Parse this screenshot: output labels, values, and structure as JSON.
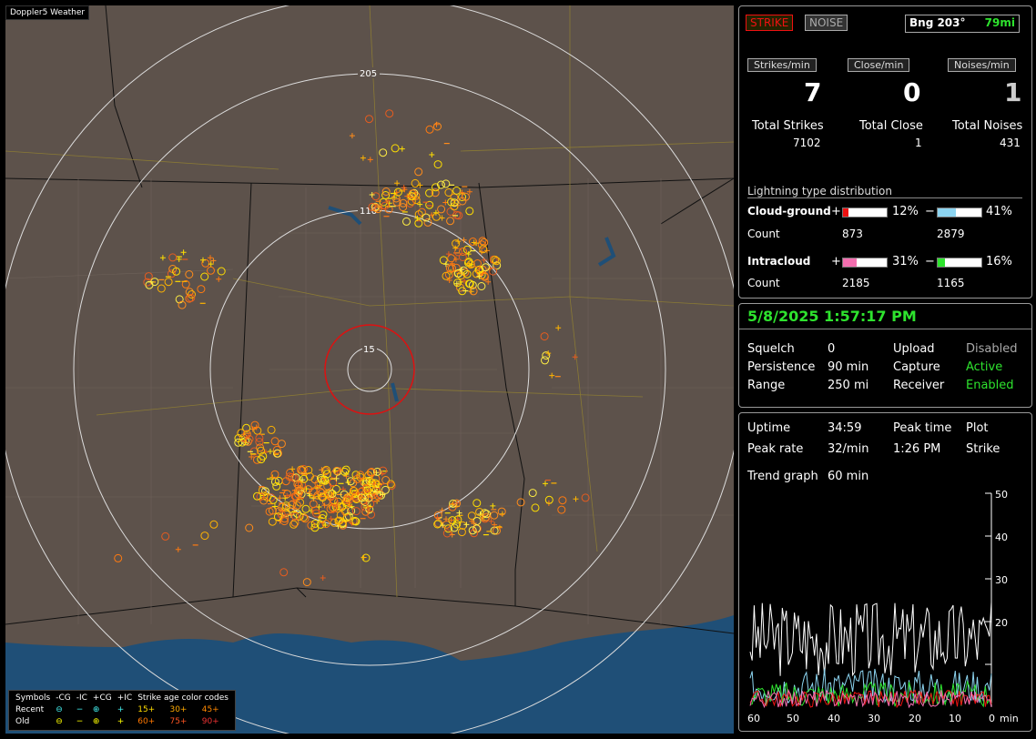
{
  "app_title": "Doppler5 Weather",
  "map": {
    "range_labels": [
      "205",
      "110",
      "15"
    ],
    "legend": {
      "header": [
        "Symbols",
        "-CG",
        "-IC",
        "+CG",
        "+IC",
        "Strike age color codes"
      ],
      "recent": {
        "label": "Recent",
        "ages": [
          "15+",
          "30+",
          "45+"
        ]
      },
      "old": {
        "label": "Old",
        "ages": [
          "60+",
          "75+",
          "90+"
        ]
      }
    }
  },
  "status": {
    "strike_label": "STRIKE",
    "noise_label": "NOISE",
    "bearing": "Bng 203°",
    "distance": "79mi",
    "headers": [
      "Strikes/min",
      "Close/min",
      "Noises/min"
    ],
    "rates": [
      "7",
      "0",
      "1"
    ],
    "total_labels": [
      "Total Strikes",
      "Total Close",
      "Total Noises"
    ],
    "totals": [
      "7102",
      "1",
      "431"
    ],
    "distribution_title": "Lightning type distribution",
    "cg_label": "Cloud-ground",
    "ic_label": "Intracloud",
    "count_label": "Count",
    "plus": "+",
    "minus": "−",
    "cg_pos_pct_text": "12%",
    "cg_neg_pct_text": "41%",
    "cg_pos_fill": 0.12,
    "cg_neg_fill": 0.41,
    "cg_pos_count": "873",
    "cg_neg_count": "2879",
    "ic_pos_pct_text": "31%",
    "ic_neg_pct_text": "16%",
    "ic_pos_fill": 0.31,
    "ic_neg_fill": 0.16,
    "ic_pos_count": "2185",
    "ic_neg_count": "1165"
  },
  "settings": {
    "datetime": "5/8/2025 1:57:17 PM",
    "squelch_label": "Squelch",
    "squelch": "0",
    "persistence_label": "Persistence",
    "persistence": "90 min",
    "range_label": "Range",
    "range": "250 mi",
    "upload_label": "Upload",
    "upload": "Disabled",
    "capture_label": "Capture",
    "capture": "Active",
    "receiver_label": "Receiver",
    "receiver": "Enabled"
  },
  "stats": {
    "uptime_label": "Uptime",
    "uptime": "34:59",
    "peak_time_label": "Peak time",
    "peak_time": "1:26 PM",
    "plot_label": "Plot",
    "plot": "Strike",
    "peak_rate_label": "Peak rate",
    "peak_rate": "32/min",
    "trend_label": "Trend graph",
    "trend": "60 min",
    "y_ticks": [
      "50",
      "40",
      "30",
      "20"
    ],
    "x_ticks": [
      "60",
      "50",
      "40",
      "30",
      "20",
      "10",
      "0"
    ],
    "x_unit": "min"
  },
  "colors": {
    "strike_red": "#e11",
    "noise_gray": "#aaa",
    "active_green": "#2ee32e",
    "map_bg": "#5d524b",
    "water": "#1f4f77"
  }
}
